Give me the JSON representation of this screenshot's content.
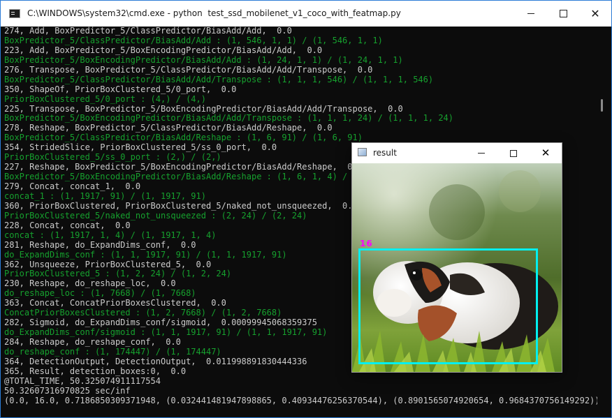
{
  "console": {
    "title": "C:\\WINDOWS\\system32\\cmd.exe - python  test_ssd_mobilenet_v1_coco_with_featmap.py",
    "lines": [
      {
        "text": "274, Add, BoxPredictor_5/ClassPredictor/BiasAdd/Add,  0.0",
        "color": "white"
      },
      {
        "text": "BoxPredictor_5/ClassPredictor/BiasAdd/Add : (1, 546, 1, 1) / (1, 546, 1, 1)",
        "color": "green"
      },
      {
        "text": "223, Add, BoxPredictor_5/BoxEncodingPredictor/BiasAdd/Add,  0.0",
        "color": "white"
      },
      {
        "text": "BoxPredictor_5/BoxEncodingPredictor/BiasAdd/Add : (1, 24, 1, 1) / (1, 24, 1, 1)",
        "color": "green"
      },
      {
        "text": "276, Transpose, BoxPredictor_5/ClassPredictor/BiasAdd/Add/Transpose,  0.0",
        "color": "white"
      },
      {
        "text": "BoxPredictor_5/ClassPredictor/BiasAdd/Add/Transpose : (1, 1, 1, 546) / (1, 1, 1, 546)",
        "color": "green"
      },
      {
        "text": "350, ShapeOf, PriorBoxClustered_5/0_port,  0.0",
        "color": "white"
      },
      {
        "text": "PriorBoxClustered_5/0_port : (4,) / (4,)",
        "color": "green"
      },
      {
        "text": "225, Transpose, BoxPredictor_5/BoxEncodingPredictor/BiasAdd/Add/Transpose,  0.0",
        "color": "white"
      },
      {
        "text": "BoxPredictor_5/BoxEncodingPredictor/BiasAdd/Add/Transpose : (1, 1, 1, 24) / (1, 1, 1, 24)",
        "color": "green"
      },
      {
        "text": "278, Reshape, BoxPredictor_5/ClassPredictor/BiasAdd/Reshape,  0.0",
        "color": "white"
      },
      {
        "text": "BoxPredictor_5/ClassPredictor/BiasAdd/Reshape : (1, 6, 91) / (1, 6, 91)",
        "color": "green"
      },
      {
        "text": "354, StridedSlice, PriorBoxClustered_5/ss_0_port,  0.0",
        "color": "white"
      },
      {
        "text": "PriorBoxClustered_5/ss_0_port : (2,) / (2,)",
        "color": "green"
      },
      {
        "text": "227, Reshape, BoxPredictor_5/BoxEncodingPredictor/BiasAdd/Reshape,  0.0",
        "color": "white"
      },
      {
        "text": "BoxPredictor_5/BoxEncodingPredictor/BiasAdd/Reshape : (1, 6, 1, 4) / (1",
        "color": "green"
      },
      {
        "text": "279, Concat, concat_1,  0.0",
        "color": "white"
      },
      {
        "text": "concat_1 : (1, 1917, 91) / (1, 1917, 91)",
        "color": "green"
      },
      {
        "text": "360, PriorBoxClustered, PriorBoxClustered_5/naked_not_unsqueezed,  0.0",
        "color": "white"
      },
      {
        "text": "PriorBoxClustered_5/naked_not_unsqueezed : (2, 24) / (2, 24)",
        "color": "green"
      },
      {
        "text": "228, Concat, concat,  0.0",
        "color": "white"
      },
      {
        "text": "concat : (1, 1917, 1, 4) / (1, 1917, 1, 4)",
        "color": "green"
      },
      {
        "text": "281, Reshape, do_ExpandDims_conf,  0.0",
        "color": "white"
      },
      {
        "text": "do_ExpandDims_conf : (1, 1, 1917, 91) / (1, 1, 1917, 91)",
        "color": "green"
      },
      {
        "text": "362, Unsqueeze, PriorBoxClustered_5,  0.0",
        "color": "white"
      },
      {
        "text": "PriorBoxClustered_5 : (1, 2, 24) / (1, 2, 24)",
        "color": "green"
      },
      {
        "text": "230, Reshape, do_reshape_loc,  0.0",
        "color": "white"
      },
      {
        "text": "do_reshape_loc : (1, 7668) / (1, 7668)",
        "color": "green"
      },
      {
        "text": "363, Concat, ConcatPriorBoxesClustered,  0.0",
        "color": "white"
      },
      {
        "text": "ConcatPriorBoxesClustered : (1, 2, 7668) / (1, 2, 7668)",
        "color": "green"
      },
      {
        "text": "282, Sigmoid, do_ExpandDims_conf/sigmoid,  0.00099945068359375",
        "color": "white"
      },
      {
        "text": "do_ExpandDims_conf/sigmoid : (1, 1, 1917, 91) / (1, 1, 1917, 91)",
        "color": "green"
      },
      {
        "text": "284, Reshape, do_reshape_conf,  0.0",
        "color": "white"
      },
      {
        "text": "do_reshape_conf : (1, 174447) / (1, 174447)",
        "color": "green"
      },
      {
        "text": "364, DetectionOutput, DetectionOutput,  0.011998891830444336",
        "color": "white"
      },
      {
        "text": "365, Result, detection_boxes:0,  0.0",
        "color": "white"
      },
      {
        "text": "@TOTAL_TIME, 50.325074911117554",
        "color": "white"
      },
      {
        "text": "50.32607316970825 sec/inf",
        "color": "white"
      },
      {
        "text": "(0.0, 16.0, 0.7186850309371948, (0.032441481947898865, 0.40934476256370544), (0.8901565074920654, 0.9684370756149292))",
        "color": "white"
      }
    ]
  },
  "result_window": {
    "title": "result",
    "detection_label": "16"
  },
  "colors": {
    "console_green": "#16a12e",
    "console_white": "#cccccc",
    "box": "#00f0f0",
    "label": "#ff00ff"
  }
}
